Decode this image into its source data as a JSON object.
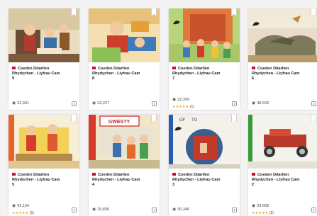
{
  "cards": [
    {
      "title_line1": "Coeden Ddarllen",
      "title_line2": "Rhydychen - Llyfrau Cam",
      "title_line3": "9",
      "views": "22,931",
      "rating_stars": "",
      "rating_count": ""
    },
    {
      "title_line1": "Coeden Ddarllen",
      "title_line2": "Rhydychen - Llyfrau Cam",
      "title_line3": "8",
      "views": "23,227",
      "rating_stars": "",
      "rating_count": ""
    },
    {
      "title_line1": "Coeden Ddarllen",
      "title_line2": "Rhydychen - Llyfrau Cam",
      "title_line3": "7",
      "views": "22,399",
      "rating_stars": "★★★★★",
      "rating_count": "(1)"
    },
    {
      "title_line1": "Coeden Ddarllen",
      "title_line2": "Rhydychen - Llyfrau Cam",
      "title_line3": "6",
      "views": "38,633",
      "rating_stars": "",
      "rating_count": ""
    },
    {
      "title_line1": "Coeden Ddarllen",
      "title_line2": "Rhydychen - Llyfrau Cam",
      "title_line3": "5",
      "views": "42,154",
      "rating_stars": "★★★★★",
      "rating_count": "(1)"
    },
    {
      "title_line1": "Coeden Ddarllen",
      "title_line2": "Rhydychen - Llyfrau Cam",
      "title_line3": "4",
      "views": "29,836",
      "rating_stars": "",
      "rating_count": ""
    },
    {
      "title_line1": "Coeden Ddarllen",
      "title_line2": "Rhydychen - Llyfrau Cam",
      "title_line3": "3",
      "views": "30,346",
      "rating_stars": "",
      "rating_count": ""
    },
    {
      "title_line1": "Coeden Ddarllen",
      "title_line2": "Rhydychen - Llyfrau Cam",
      "title_line3": "2",
      "views": "29,668",
      "rating_stars": "★★★★★",
      "rating_count": "(2)"
    }
  ],
  "cover_texts": {
    "card5": "GWESTY",
    "card6a": "GF",
    "card6b": "TG"
  },
  "colors": {
    "flag": "#c8102e",
    "star": "#f0a020"
  },
  "icons": [
    "bookmark-icon",
    "flag-icon",
    "eye-icon",
    "star-icon",
    "book-icon"
  ]
}
